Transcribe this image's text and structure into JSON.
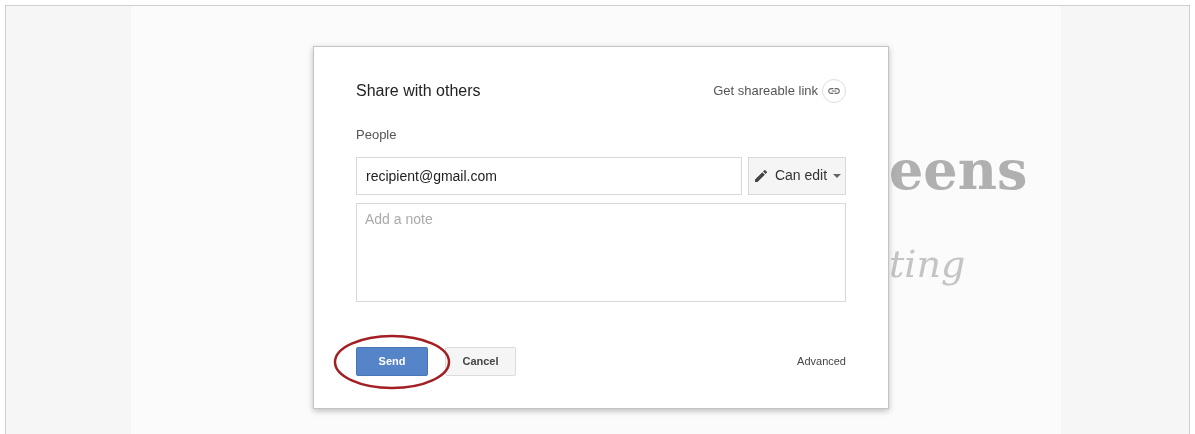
{
  "background_document": {
    "title_fragment": "eens",
    "subtitle_fragment": "ting"
  },
  "dialog": {
    "title": "Share with others",
    "shareable_link": "Get shareable link",
    "people_label": "People",
    "recipient_value": "recipient@gmail.com",
    "permission": "Can edit",
    "note_placeholder": "Add a note",
    "send_button": {
      "label": "Send",
      "circled": true
    },
    "cancel_button": "Cancel",
    "advanced_link": "Advanced"
  }
}
